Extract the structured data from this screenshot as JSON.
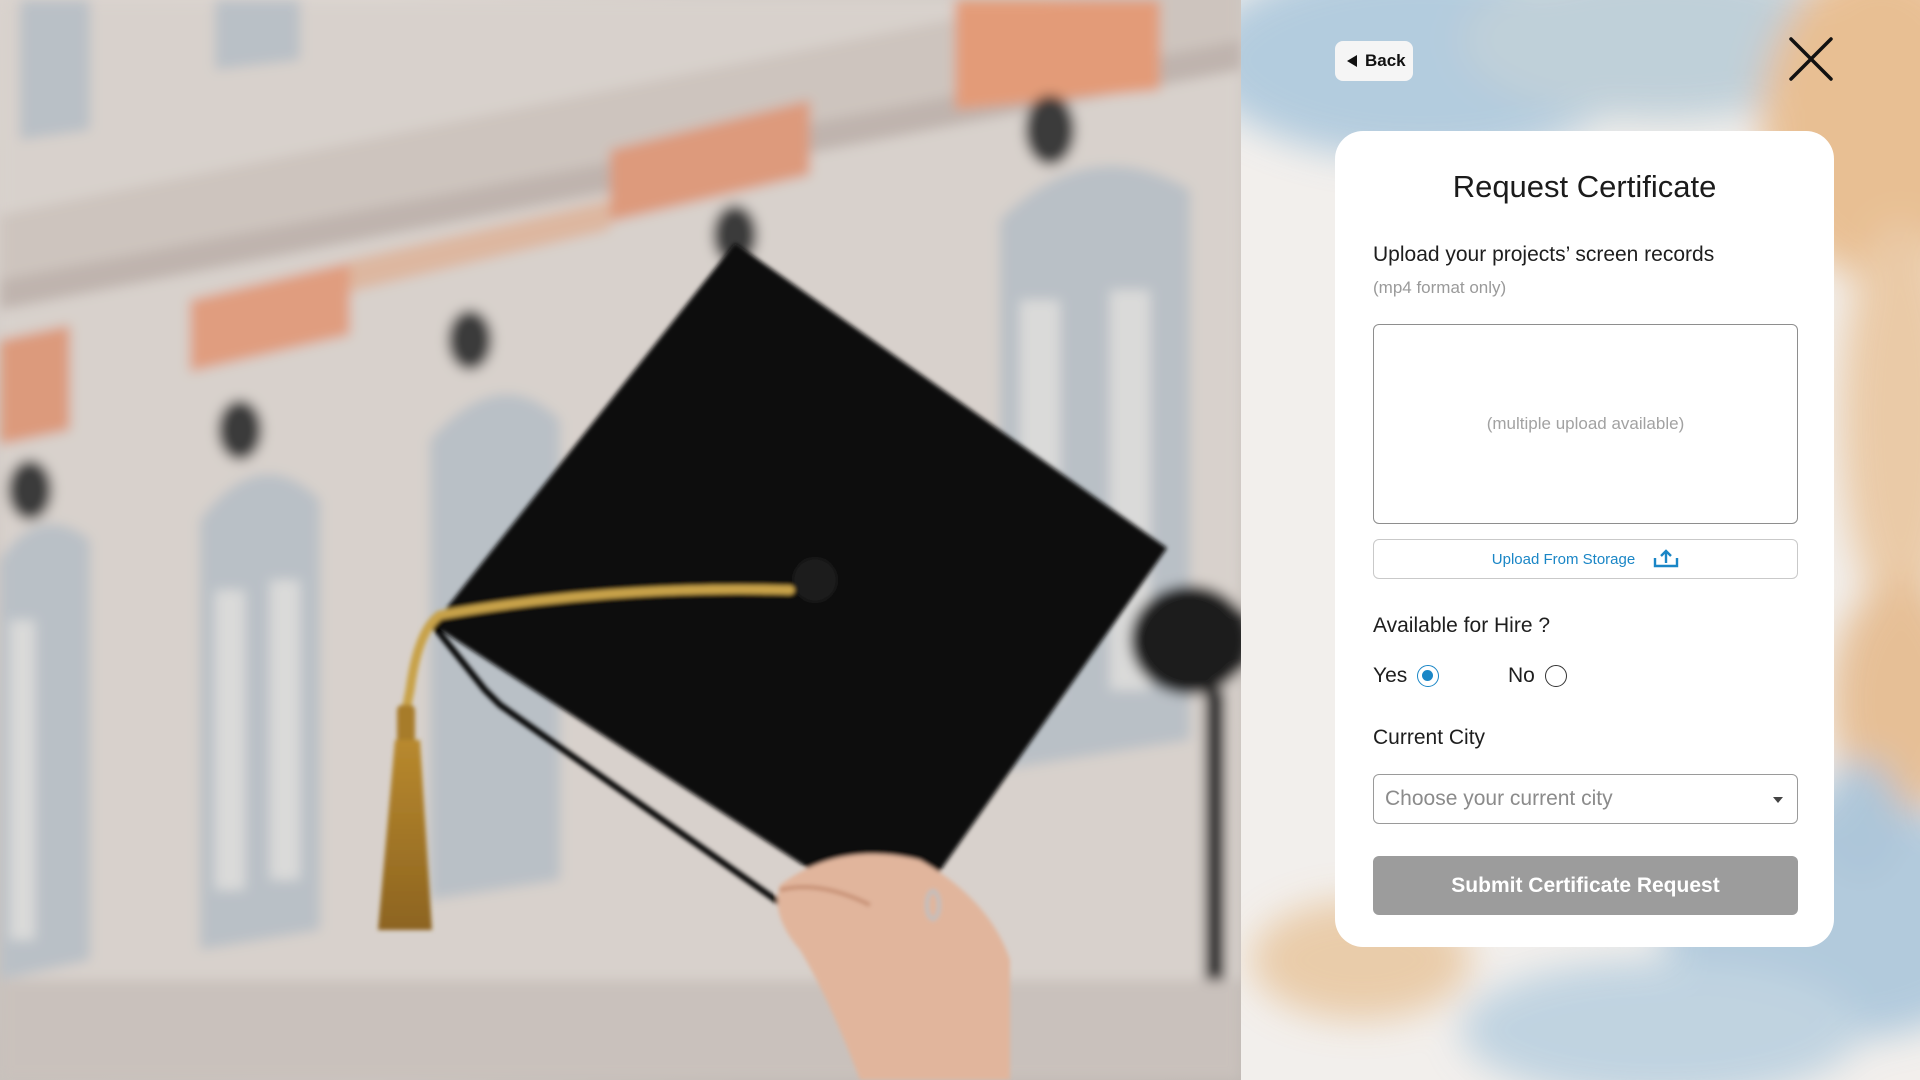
{
  "photo": {
    "alt": "graduation cap held up in front of building"
  },
  "panel": {
    "back_label": "Back",
    "close_icon": "close-icon",
    "form": {
      "title": "Request Certificate",
      "upload_label": "Upload your projects’ screen records",
      "upload_format": "(mp4 format only)",
      "dropzone_text": "(multiple upload available)",
      "upload_button_label": "Upload From Storage",
      "upload_icon": "upload-icon",
      "hire_label": "Available for Hire ?",
      "hire_options": [
        {
          "label": "Yes",
          "selected": true
        },
        {
          "label": "No",
          "selected": false
        }
      ],
      "city_label": "Current City",
      "city_placeholder": "Choose your current city",
      "submit_label": "Submit Certificate Request"
    }
  },
  "colors": {
    "accent": "#1a86c6",
    "submit_bg": "#9c9c9c",
    "card_bg": "#ffffff"
  }
}
